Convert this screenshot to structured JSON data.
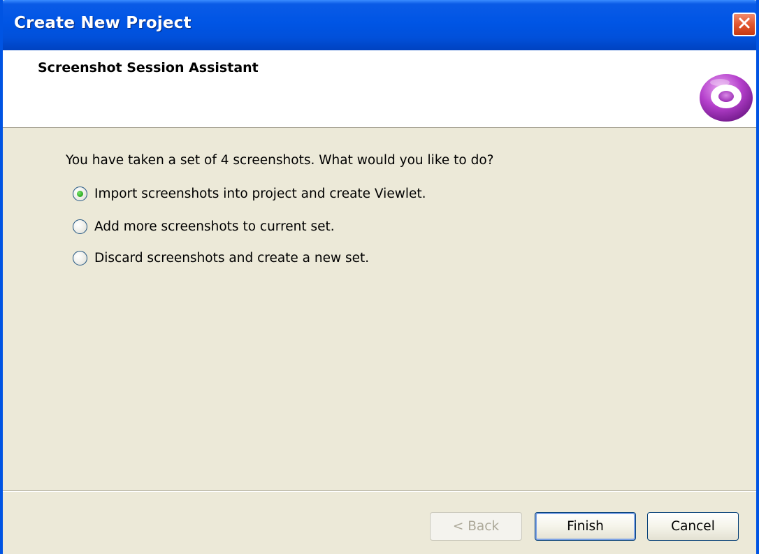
{
  "window": {
    "title": "Create New Project"
  },
  "header": {
    "title": "Screenshot Session Assistant",
    "logo_icon": "viewlet-logo-icon"
  },
  "content": {
    "prompt": "You have taken a set of 4 screenshots. What would you like to do?",
    "options": [
      {
        "label": "Import screenshots into project and create Viewlet.",
        "selected": true
      },
      {
        "label": "Add more screenshots to current set.",
        "selected": false
      },
      {
        "label": "Discard screenshots and create a new set.",
        "selected": false
      }
    ]
  },
  "buttons": {
    "back": "< Back",
    "finish": "Finish",
    "cancel": "Cancel"
  },
  "colors": {
    "titlebar": "#0055E5",
    "dialog_bg": "#ECE9D8",
    "close": "#E2552F",
    "radio_selected": "#32B228",
    "logo": "#B13BC8"
  }
}
